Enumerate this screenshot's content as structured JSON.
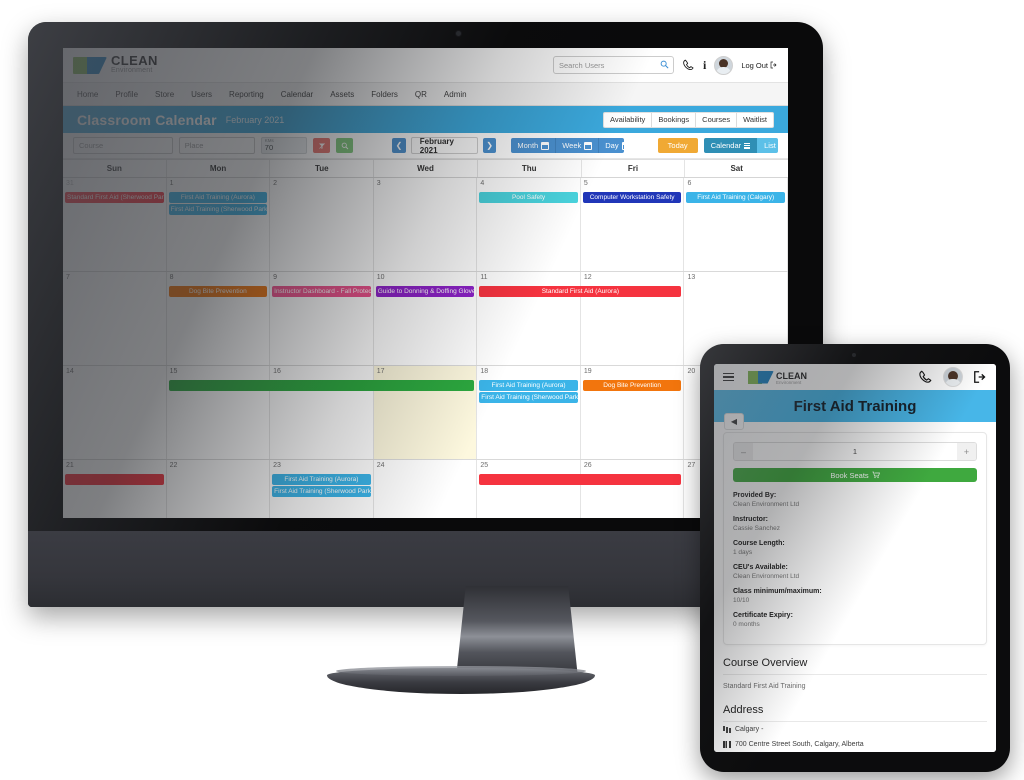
{
  "desktop": {
    "brand": {
      "name": "CLEAN",
      "tagline": "Environment"
    },
    "search": {
      "placeholder": "Search Users",
      "icon": "search-icon"
    },
    "header_icons": {
      "phone": "phone-icon",
      "info": "info-icon",
      "avatar": "user-avatar"
    },
    "logout_label": "Log Out",
    "nav": [
      {
        "label": "Home"
      },
      {
        "label": "Profile"
      },
      {
        "label": "Store"
      },
      {
        "label": "Users"
      },
      {
        "label": "Reporting"
      },
      {
        "label": "Calendar"
      },
      {
        "label": "Assets"
      },
      {
        "label": "Folders"
      },
      {
        "label": "QR"
      },
      {
        "label": "Admin"
      }
    ],
    "page_title": "Classroom Calendar",
    "page_subtitle": "February 2021",
    "title_tabs": [
      {
        "label": "Availability"
      },
      {
        "label": "Bookings"
      },
      {
        "label": "Courses"
      },
      {
        "label": "Waitlist"
      }
    ],
    "toolbar": {
      "course_placeholder": "Course",
      "place_placeholder": "Place",
      "kms_label": "KMs",
      "kms_value": "70",
      "clear_icon": "clear-filter-icon",
      "search_icon": "search-icon",
      "prev_label": "❮",
      "next_label": "❯",
      "month_label": "February 2021",
      "views": [
        {
          "label": "Month"
        },
        {
          "label": "Week"
        },
        {
          "label": "Day"
        }
      ],
      "today_label": "Today",
      "display_toggle": [
        {
          "label": "Calendar"
        },
        {
          "label": "List"
        }
      ]
    },
    "calendar": {
      "weekdays": [
        "Sun",
        "Mon",
        "Tue",
        "Wed",
        "Thu",
        "Fri",
        "Sat"
      ],
      "weeks": [
        {
          "days": [
            {
              "num": "31",
              "muted": true
            },
            {
              "num": "1"
            },
            {
              "num": "2"
            },
            {
              "num": "3"
            },
            {
              "num": "4"
            },
            {
              "num": "5"
            },
            {
              "num": "6"
            }
          ],
          "events": [
            {
              "title": "Standard First Aid (Sherwood Park)",
              "start": 0,
              "span": 1,
              "lane": 0,
              "color": "#f5333f"
            },
            {
              "title": "First Aid Training (Aurora)",
              "start": 1,
              "span": 1,
              "lane": 0,
              "color": "#3bb4e8"
            },
            {
              "title": "First Aid Training (Sherwood Park)",
              "start": 1,
              "span": 1,
              "lane": 1,
              "color": "#3bb4e8"
            },
            {
              "title": "Pool Safety",
              "start": 4,
              "span": 1,
              "lane": 0,
              "color": "#49d3dd"
            },
            {
              "title": "Computer Workstation Safety",
              "start": 5,
              "span": 1,
              "lane": 0,
              "color": "#2036b8"
            },
            {
              "title": "First Aid Training (Calgary)",
              "start": 6,
              "span": 1,
              "lane": 0,
              "color": "#3bb4e8"
            }
          ]
        },
        {
          "days": [
            {
              "num": "7"
            },
            {
              "num": "8"
            },
            {
              "num": "9"
            },
            {
              "num": "10"
            },
            {
              "num": "11"
            },
            {
              "num": "12"
            },
            {
              "num": "13"
            }
          ],
          "events": [
            {
              "title": "Dog Bite Prevention",
              "start": 1,
              "span": 1,
              "lane": 0,
              "color": "#f2750d"
            },
            {
              "title": "Instructor Dashboard - Fall Protection Equipment",
              "start": 2,
              "span": 1,
              "lane": 0,
              "color": "#ef4f8b"
            },
            {
              "title": "Guide to Donning & Doffing Gloves",
              "start": 3,
              "span": 1,
              "lane": 0,
              "color": "#8d21c9"
            },
            {
              "title": "Standard First Aid (Aurora)",
              "start": 4,
              "span": 2,
              "lane": 0,
              "color": "#f5333f"
            }
          ]
        },
        {
          "days": [
            {
              "num": "14"
            },
            {
              "num": "15"
            },
            {
              "num": "16"
            },
            {
              "num": "17",
              "today": true
            },
            {
              "num": "18"
            },
            {
              "num": "19"
            },
            {
              "num": "20"
            }
          ],
          "events": [
            {
              "title": "",
              "start": 1,
              "span": 3,
              "lane": 0,
              "color": "#2ca93f"
            },
            {
              "title": "First Aid Training (Aurora)",
              "start": 4,
              "span": 1,
              "lane": 0,
              "color": "#3bb4e8"
            },
            {
              "title": "First Aid Training (Sherwood Park)",
              "start": 4,
              "span": 1,
              "lane": 1,
              "color": "#3bb4e8"
            },
            {
              "title": "Dog Bite Prevention",
              "start": 5,
              "span": 1,
              "lane": 0,
              "color": "#f2750d"
            }
          ]
        },
        {
          "days": [
            {
              "num": "21"
            },
            {
              "num": "22"
            },
            {
              "num": "23"
            },
            {
              "num": "24"
            },
            {
              "num": "25"
            },
            {
              "num": "26"
            },
            {
              "num": "27"
            }
          ],
          "events": [
            {
              "title": "",
              "start": 0,
              "span": 1,
              "lane": 0,
              "color": "#f5333f"
            },
            {
              "title": "First Aid Training (Aurora)",
              "start": 2,
              "span": 1,
              "lane": 0,
              "color": "#3bb4e8"
            },
            {
              "title": "First Aid Training (Sherwood Park)",
              "start": 2,
              "span": 1,
              "lane": 1,
              "color": "#3bb4e8"
            },
            {
              "title": "",
              "start": 4,
              "span": 2,
              "lane": 0,
              "color": "#f5333f"
            }
          ]
        }
      ]
    }
  },
  "tablet": {
    "brand": {
      "name": "CLEAN",
      "tagline": "Environment"
    },
    "menu_icon": "hamburger-menu-icon",
    "phone_icon": "phone-icon",
    "avatar_icon": "user-avatar",
    "logout_icon": "logout-icon",
    "banner_title": "First Aid Training",
    "back_label": "◀",
    "stepper": {
      "minus": "–",
      "value": "1",
      "plus": "+"
    },
    "book_button": "Book Seats",
    "cart_icon": "cart-icon",
    "details": [
      {
        "key": "Provided By:",
        "value": "Clean Environment Ltd"
      },
      {
        "key": "Instructor:",
        "value": "Cassie Sanchez"
      },
      {
        "key": "Course Length:",
        "value": "1 days"
      },
      {
        "key": "CEU's Available:",
        "value": "Clean Environment Ltd"
      },
      {
        "key": "Class minimum/maximum:",
        "value": "10/10"
      },
      {
        "key": "Certificate Expiry:",
        "value": "0 months"
      }
    ],
    "overview_heading": "Course Overview",
    "overview_text": "Standard First Aid Training",
    "address_heading": "Address",
    "address_city": "Calgary -",
    "address_street": "700 Centre Street South, Calgary, Alberta"
  },
  "colors": {
    "brand_blue": "#3ba9dd",
    "brand_green": "#7ab648",
    "accent_orange": "#f0a934",
    "book_green": "#3fa93f"
  }
}
